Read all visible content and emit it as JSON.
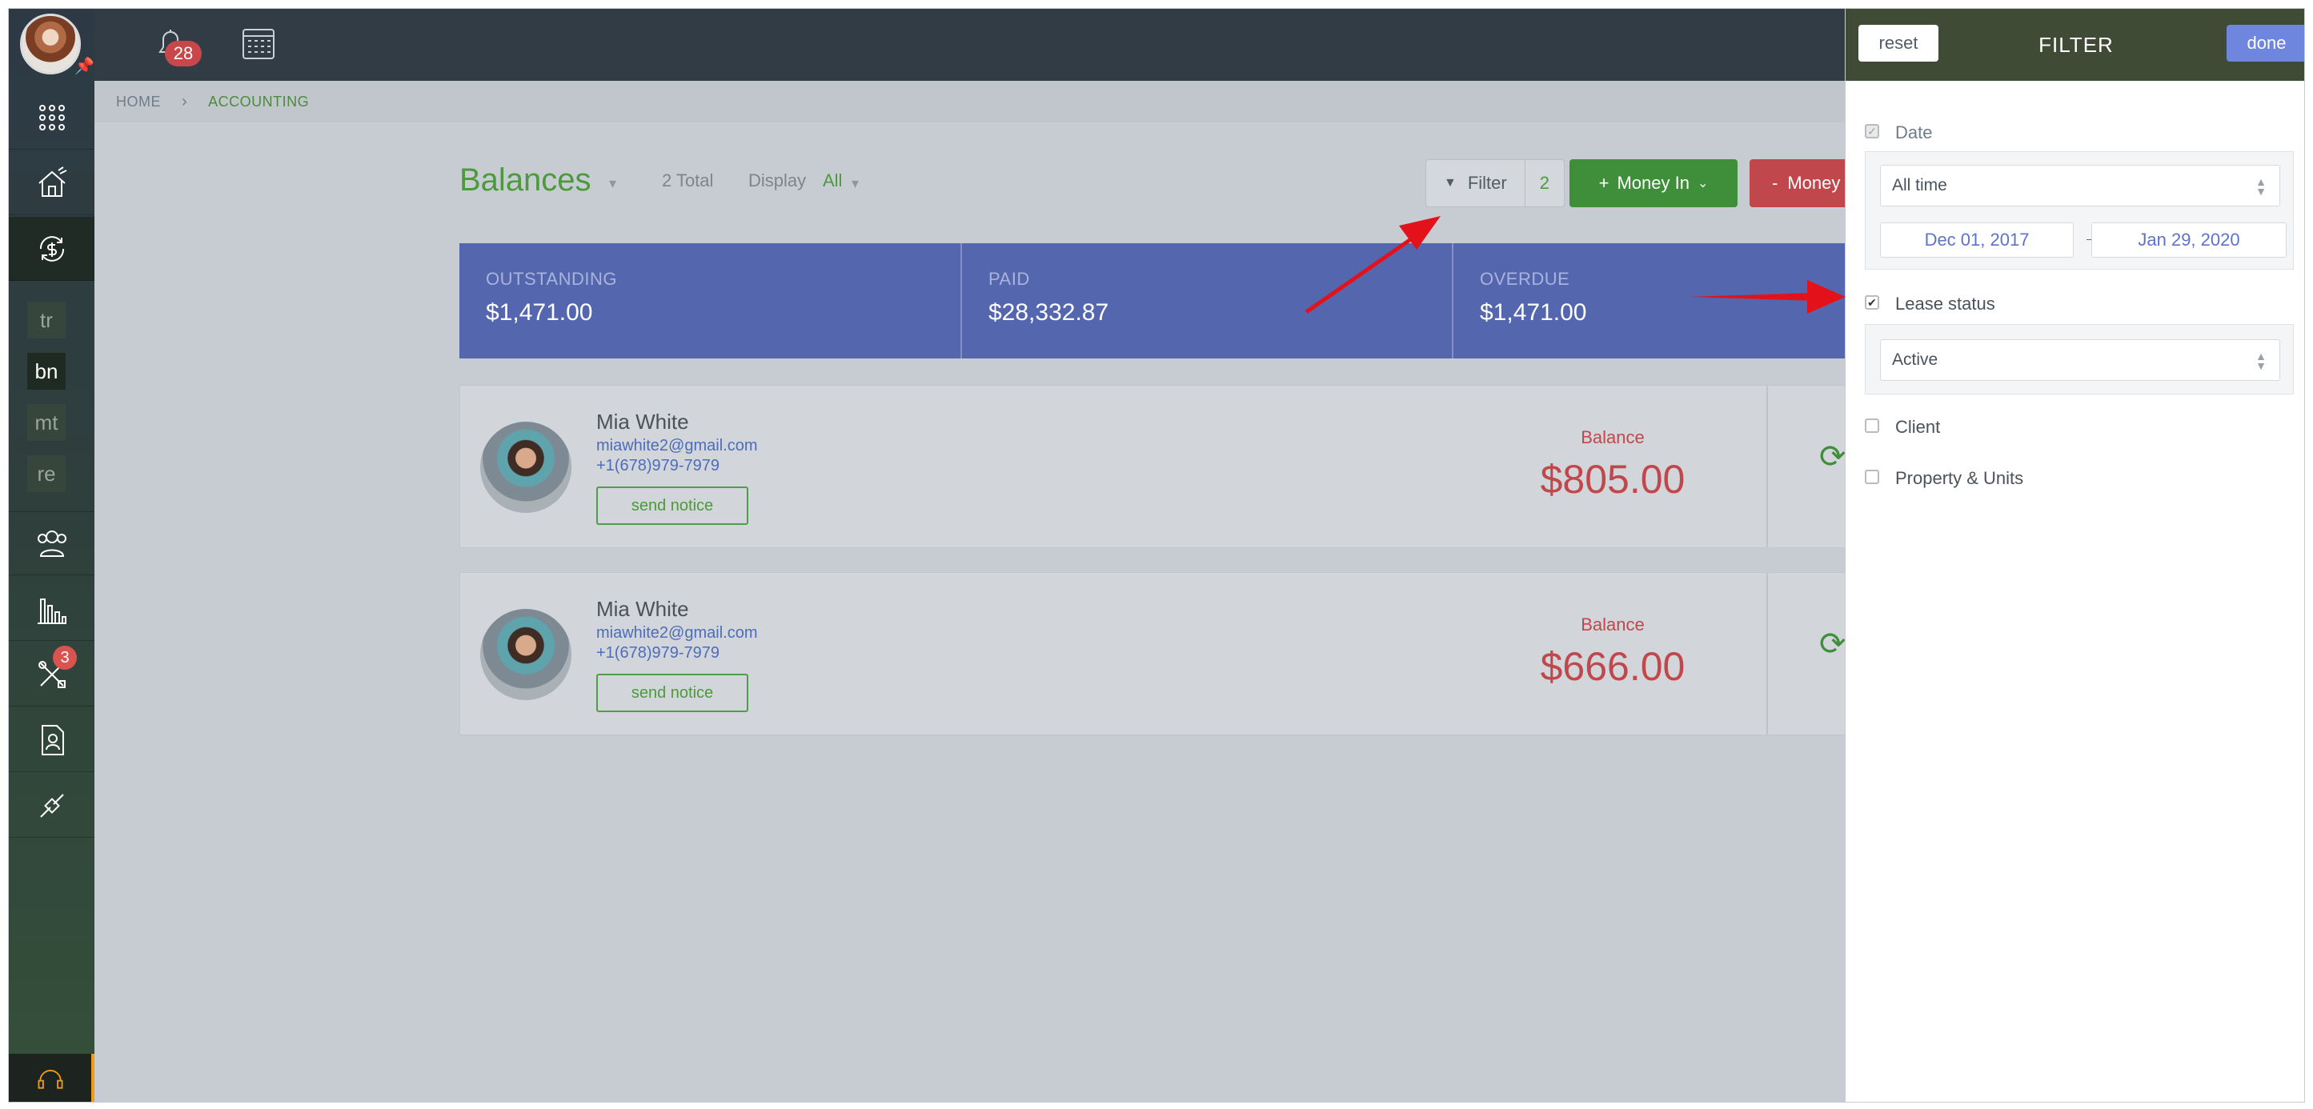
{
  "topbar": {
    "notifications_count": "28",
    "notifications_icon": "bell-icon",
    "calendar_icon": "calendar-icon"
  },
  "sidebar": {
    "shortcuts": [
      "tr",
      "bn",
      "mt",
      "re"
    ],
    "tools_badge": "3",
    "icons": [
      "apps-grid-icon",
      "properties-icon",
      "accounting-icon",
      "tenants-icon",
      "reports-icon",
      "maintenance-icon",
      "documents-icon",
      "integrations-icon",
      "support-icon"
    ]
  },
  "breadcrumb": {
    "home": "HOME",
    "current": "ACCOUNTING"
  },
  "header": {
    "title": "Balances",
    "total": "2 Total",
    "display_label": "Display",
    "display_value": "All",
    "filter_label": "Filter",
    "filter_count": "2",
    "money_in_label": "Money In",
    "money_out_label": "Money"
  },
  "summary": {
    "outstanding_label": "OUTSTANDING",
    "outstanding_value": "$1,471.00",
    "paid_label": "PAID",
    "paid_value": "$28,332.87",
    "overdue_label": "OVERDUE",
    "overdue_value": "$1,471.00"
  },
  "balances": [
    {
      "name": "Mia White",
      "email": "miawhite2@gmail.com",
      "phone": "+1(678)979-7979",
      "notice_label": "send notice",
      "balance_label": "Balance",
      "balance": "$805.00"
    },
    {
      "name": "Mia White",
      "email": "miawhite2@gmail.com",
      "phone": "+1(678)979-7979",
      "notice_label": "send notice",
      "balance_label": "Balance",
      "balance": "$666.00"
    }
  ],
  "filter_panel": {
    "reset_label": "reset",
    "title": "FILTER",
    "done_label": "done",
    "date_label": "Date",
    "date_range_value": "All time",
    "date_from": "Dec 01, 2017",
    "date_to": "Jan 29, 2020",
    "lease_status_label": "Lease status",
    "lease_status_value": "Active",
    "client_label": "Client",
    "property_label": "Property & Units"
  },
  "colors": {
    "accent_green": "#4c9a3c",
    "money_in": "#3e8e3a",
    "money_out": "#c0484d",
    "summary_bg": "#5466ae",
    "done_button": "#6f86df",
    "annotation_arrow": "#e3121a"
  }
}
